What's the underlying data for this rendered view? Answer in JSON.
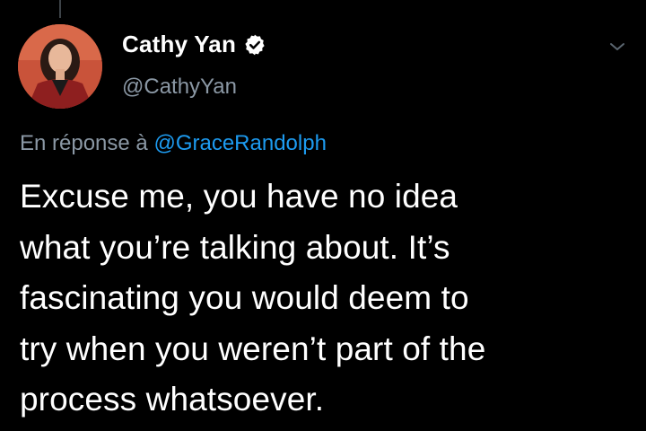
{
  "author": {
    "display_name": "Cathy Yan",
    "handle": "@CathyYan",
    "verified": true,
    "avatar_icon": "profile-photo"
  },
  "reply": {
    "prefix": "En réponse à",
    "mention": "@GraceRandolph"
  },
  "tweet": {
    "text": "Excuse me, you have no idea\nwhat you’re talking about. It’s\nfascinating you would deem to\ntry when you weren’t part of the\nprocess whatsoever."
  },
  "menu": {
    "icon": "chevron-down-icon"
  },
  "colors": {
    "background": "#000000",
    "primary_text": "#ffffff",
    "secondary_text": "#8b98a5",
    "link": "#1d9bf0",
    "verified_badge": "#ffffff"
  }
}
